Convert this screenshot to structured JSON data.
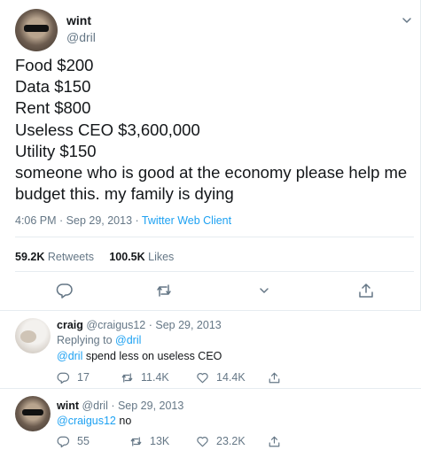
{
  "tweet": {
    "author_name": "wint",
    "author_handle": "@dril",
    "lines": [
      "Food $200",
      "Data $150",
      "Rent $800",
      "Useless CEO $3,600,000",
      "Utility $150",
      "someone who is good at the economy please help me",
      "budget this. my family is dying"
    ],
    "timestamp": "4:06 PM · Sep 29, 2013 · ",
    "client": "Twitter Web Client",
    "retweets_count": "59.2K",
    "retweets_label": "Retweets",
    "likes_count": "100.5K",
    "likes_label": "Likes"
  },
  "replies": [
    {
      "name": "craig",
      "handle_date": "@craigus12 · Sep 29, 2013",
      "replying_prefix": "Replying to ",
      "replying_to": "@dril",
      "mention": "@dril",
      "text": " spend less on useless CEO",
      "reply_count": "17",
      "retweet_count": "11.4K",
      "like_count": "14.4K"
    },
    {
      "name": "wint",
      "handle_date": "@dril · Sep 29, 2013",
      "mention": "@craigus12",
      "text": " no",
      "reply_count": "55",
      "retweet_count": "13K",
      "like_count": "23.2K"
    }
  ],
  "colors": {
    "accent": "#1da1f2",
    "secondary_text": "#657786",
    "divider": "#e6ecf0"
  },
  "icons": [
    "chevron-down-icon",
    "reply-icon",
    "retweet-icon",
    "like-icon",
    "share-icon"
  ]
}
